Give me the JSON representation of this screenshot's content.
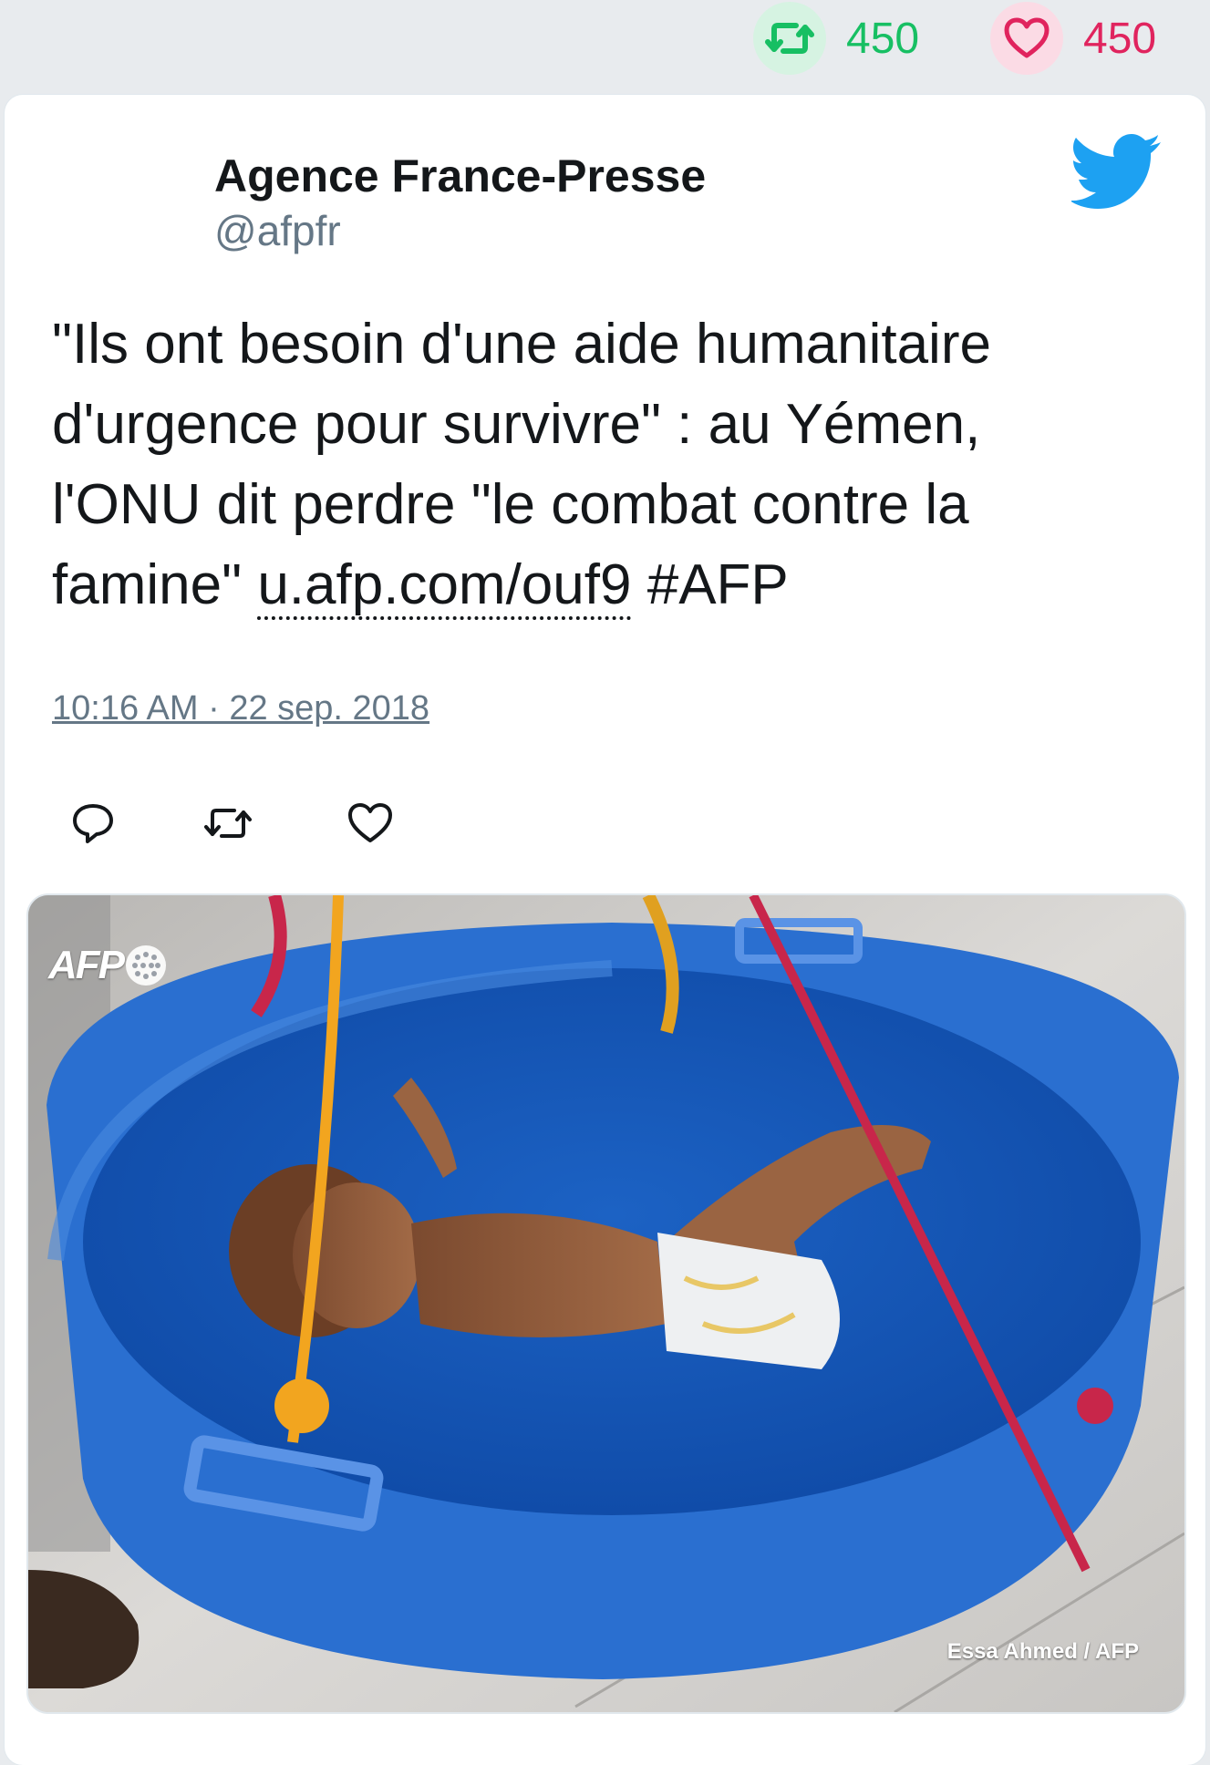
{
  "stats": {
    "retweets": "450",
    "likes": "450"
  },
  "author": {
    "name": "Agence France-Presse",
    "handle": "@afpfr"
  },
  "tweet": {
    "text_before_link": "\"Ils ont besoin d'une aide humanitaire d'urgence pour survivre\" : au Yémen, l'ONU dit perdre \"le combat contre la famine\" ",
    "link": "u.afp.com/ouf9",
    "text_after_link": " #AFP",
    "timestamp": "10:16 AM · 22 sep. 2018"
  },
  "media": {
    "watermark": "AFP",
    "credit": "Essa Ahmed / AFP"
  },
  "colors": {
    "retweet_green": "#17bf63",
    "like_red": "#e0245e",
    "twitter_blue": "#1da1f2",
    "basin_blue": "#2a6fd0"
  }
}
